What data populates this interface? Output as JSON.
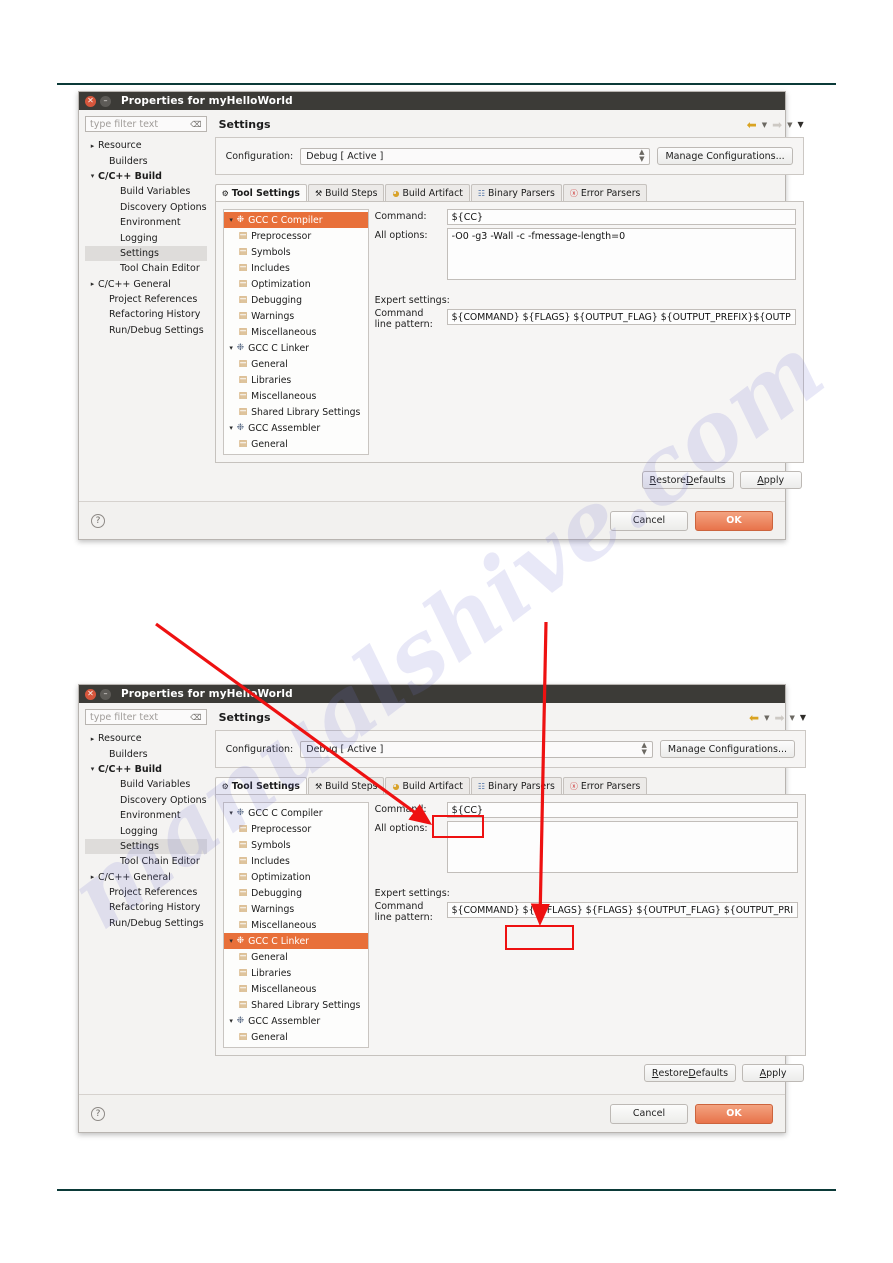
{
  "window": {
    "title": "Properties for myHelloWorld",
    "close_icon": "close-icon",
    "minimize_icon": "minimize-icon"
  },
  "accent": {
    "selection_orange": "#e8703a",
    "ok_button": "#e8734a",
    "annotation_red": "#ee1111",
    "rule_teal": "#0b3a38"
  },
  "watermark": {
    "text": "manualshive.com"
  },
  "filter": {
    "placeholder": "type filter text",
    "clear_icon": "clear-filter-icon"
  },
  "header": {
    "title": "Settings",
    "back_icon": "back-arrow-icon",
    "forward_icon": "forward-arrow-icon",
    "menu_icon": "chevron-down-icon"
  },
  "configuration": {
    "label": "Configuration:",
    "value": "Debug [ Active ]",
    "manage_button": "Manage Configurations..."
  },
  "tabs": [
    {
      "label": "Tool Settings",
      "icon": "tool-settings-icon",
      "active": true
    },
    {
      "label": "Build Steps",
      "icon": "wrench-icon",
      "active": false
    },
    {
      "label": "Build Artifact",
      "icon": "artifact-icon",
      "active": false
    },
    {
      "label": "Binary Parsers",
      "icon": "binary-parser-icon",
      "active": false
    },
    {
      "label": "Error Parsers",
      "icon": "error-parser-icon",
      "active": false
    }
  ],
  "sidebar": {
    "items": [
      {
        "label": "Resource",
        "level": 0,
        "twisty": "▸",
        "selected": false
      },
      {
        "label": "Builders",
        "level": 1,
        "twisty": "",
        "selected": false
      },
      {
        "label": "C/C++ Build",
        "level": 0,
        "twisty": "▾",
        "selected": false,
        "bold": true
      },
      {
        "label": "Build Variables",
        "level": 2,
        "twisty": "",
        "selected": false
      },
      {
        "label": "Discovery Options",
        "level": 2,
        "twisty": "",
        "selected": false
      },
      {
        "label": "Environment",
        "level": 2,
        "twisty": "",
        "selected": false
      },
      {
        "label": "Logging",
        "level": 2,
        "twisty": "",
        "selected": false
      },
      {
        "label": "Settings",
        "level": 2,
        "twisty": "",
        "selected": true
      },
      {
        "label": "Tool Chain Editor",
        "level": 2,
        "twisty": "",
        "selected": false
      },
      {
        "label": "C/C++ General",
        "level": 0,
        "twisty": "▸",
        "selected": false
      },
      {
        "label": "Project References",
        "level": 1,
        "twisty": "",
        "selected": false
      },
      {
        "label": "Refactoring History",
        "level": 1,
        "twisty": "",
        "selected": false
      },
      {
        "label": "Run/Debug Settings",
        "level": 1,
        "twisty": "",
        "selected": false
      }
    ]
  },
  "tool_tree": {
    "items": [
      {
        "label": "GCC C Compiler",
        "level": 0,
        "twisty": "▾",
        "icon": "tool-icon"
      },
      {
        "label": "Preprocessor",
        "level": 1,
        "twisty": "",
        "icon": "folder-icon"
      },
      {
        "label": "Symbols",
        "level": 1,
        "twisty": "",
        "icon": "folder-icon"
      },
      {
        "label": "Includes",
        "level": 1,
        "twisty": "",
        "icon": "folder-icon"
      },
      {
        "label": "Optimization",
        "level": 1,
        "twisty": "",
        "icon": "folder-icon"
      },
      {
        "label": "Debugging",
        "level": 1,
        "twisty": "",
        "icon": "folder-icon"
      },
      {
        "label": "Warnings",
        "level": 1,
        "twisty": "",
        "icon": "folder-icon"
      },
      {
        "label": "Miscellaneous",
        "level": 1,
        "twisty": "",
        "icon": "folder-icon"
      },
      {
        "label": "GCC C Linker",
        "level": 0,
        "twisty": "▾",
        "icon": "tool-icon"
      },
      {
        "label": "General",
        "level": 1,
        "twisty": "",
        "icon": "folder-icon"
      },
      {
        "label": "Libraries",
        "level": 1,
        "twisty": "",
        "icon": "folder-icon"
      },
      {
        "label": "Miscellaneous",
        "level": 1,
        "twisty": "",
        "icon": "folder-icon"
      },
      {
        "label": "Shared Library Settings",
        "level": 1,
        "twisty": "",
        "icon": "folder-icon"
      },
      {
        "label": "GCC Assembler",
        "level": 0,
        "twisty": "▾",
        "icon": "tool-icon"
      },
      {
        "label": "General",
        "level": 1,
        "twisty": "",
        "icon": "folder-icon"
      }
    ]
  },
  "form": {
    "command_label": "Command:",
    "all_options_label": "All options:",
    "expert_label": "Expert settings:",
    "pattern_label_line1": "Command",
    "pattern_label_line2": "line pattern:"
  },
  "dialog1": {
    "selected_tool": "GCC C Compiler",
    "selected_tool_index": 0,
    "command_value": "${CC}",
    "all_options_value": "-O0 -g3 -Wall -c -fmessage-length=0",
    "pattern_value": "${COMMAND} ${FLAGS} ${OUTPUT_FLAG} ${OUTPUT_PREFIX}${OUTP"
  },
  "dialog2": {
    "selected_tool": "GCC C Linker",
    "selected_tool_index": 8,
    "command_value": "${CC}",
    "all_options_value": "",
    "pattern_prefix": "${COMMAND}",
    "pattern_highlight": "${LDFLAGS}",
    "pattern_suffix": "${FLAGS} ${OUTPUT_FLAG} ${OUTPUT_PRI"
  },
  "buttons": {
    "restore_defaults": "Restore Defaults",
    "apply": "Apply",
    "cancel": "Cancel",
    "ok": "OK",
    "help_icon": "help-icon"
  }
}
